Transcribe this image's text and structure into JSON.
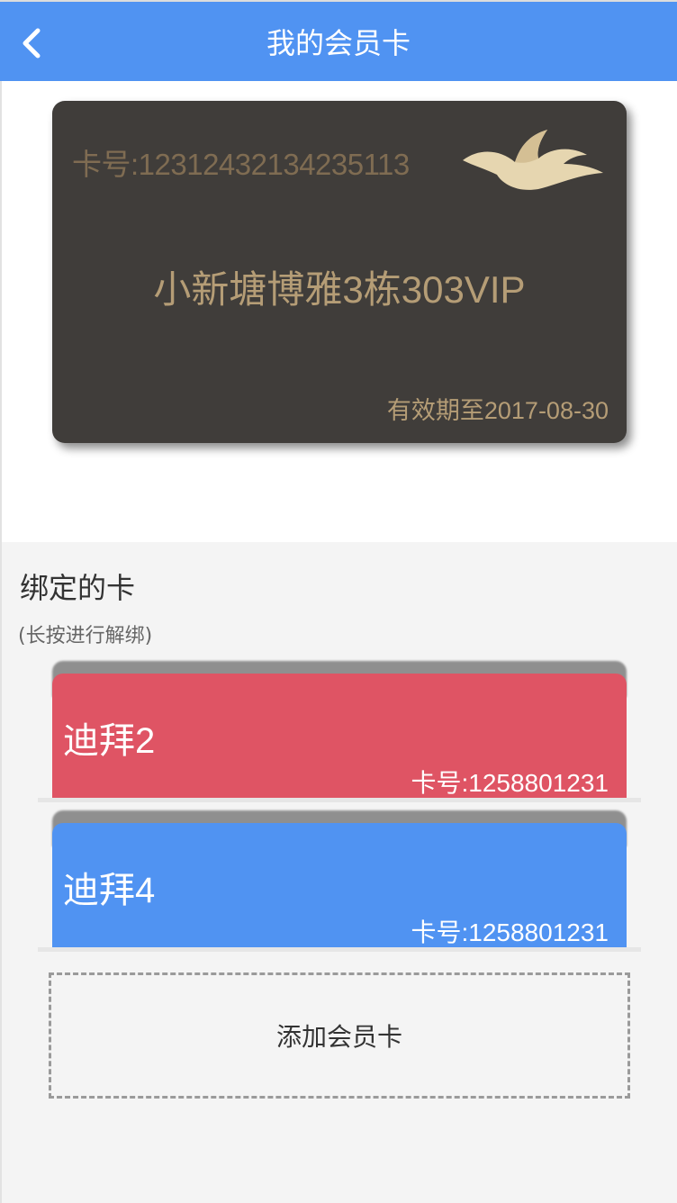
{
  "header": {
    "title": "我的会员卡",
    "back_icon": "chevron-left-icon",
    "background": "#5093f2"
  },
  "vip_card": {
    "number": "卡号:12312432134235113",
    "name": "小新塘博雅3栋303VIP",
    "expiry": "有效期至2017-08-30",
    "logo_icon": "bird-logo-icon",
    "background": "#403d3a",
    "accent": "#b59d76"
  },
  "bound": {
    "title": "绑定的卡",
    "hint": "(长按进行解绑)",
    "cards": [
      {
        "name": "迪拜2",
        "number": "卡号:1258801231",
        "color": "#df5464"
      },
      {
        "name": "迪拜4",
        "number": "卡号:1258801231",
        "color": "#5093f2"
      }
    ]
  },
  "add_card": {
    "label": "添加会员卡"
  }
}
